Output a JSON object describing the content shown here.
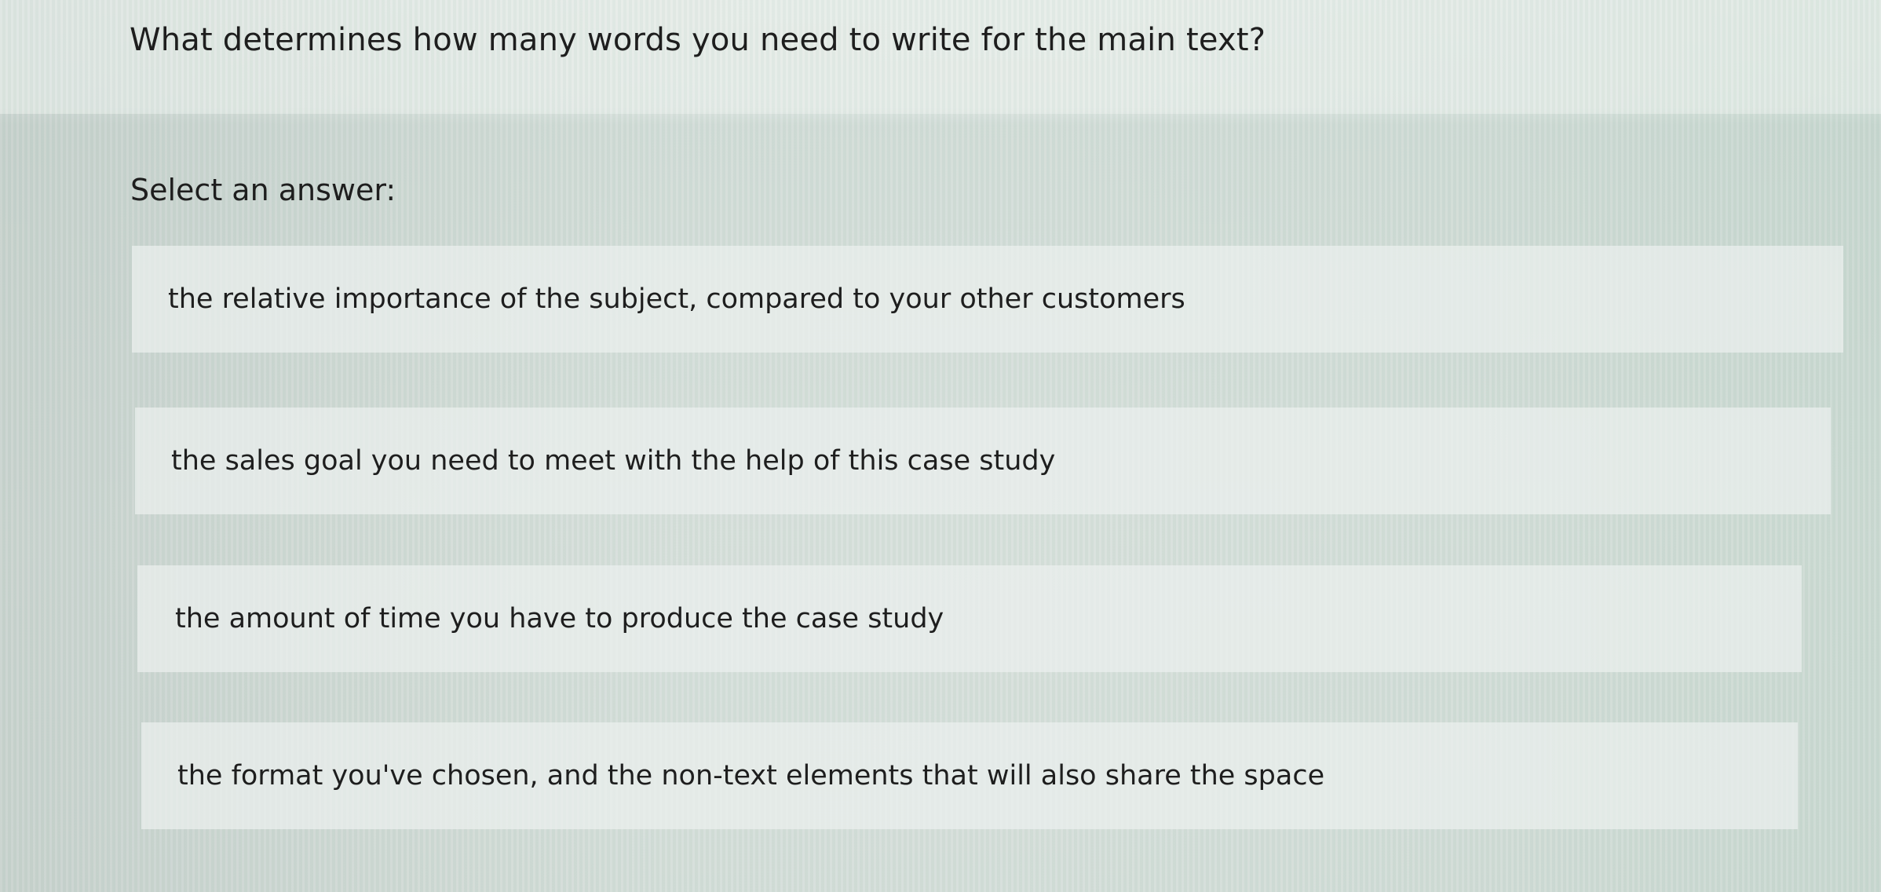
{
  "question": {
    "text": "What determines how many words you need to write for the main text?"
  },
  "prompt": {
    "text": "Select an answer:"
  },
  "options": [
    {
      "label": "the relative importance of the subject, compared to your other customers"
    },
    {
      "label": "the sales goal you need to meet with the help of this case study"
    },
    {
      "label": "the amount of time you have to produce the case study"
    },
    {
      "label": "the format you've chosen, and the non-text elements that will also share the space"
    }
  ],
  "colors": {
    "background": "#d2dcd6",
    "option_background": "#eceff0",
    "text": "#1e1e1e"
  }
}
